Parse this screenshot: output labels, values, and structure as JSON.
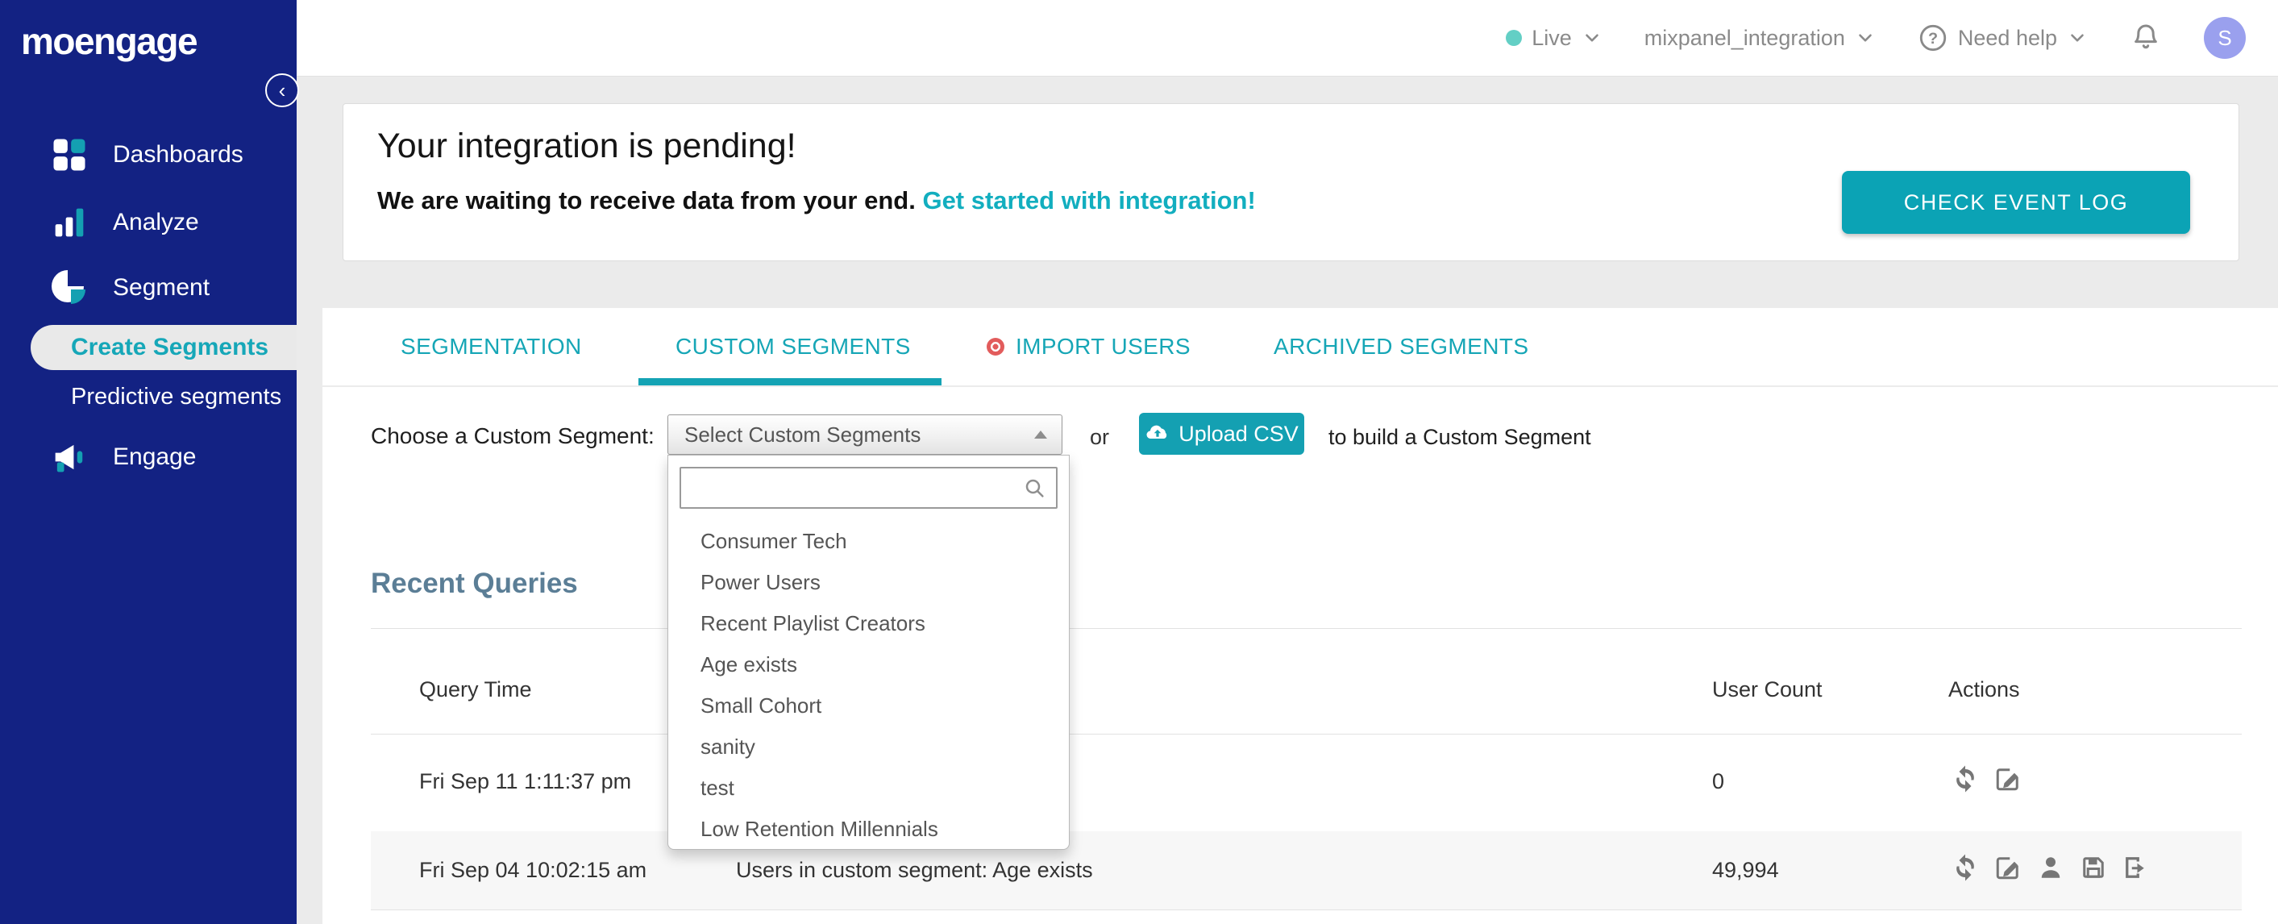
{
  "brand": {
    "logo_text": "moengage",
    "collapse_glyph": "‹"
  },
  "topbar": {
    "environment": "Live",
    "workspace": "mixpanel_integration",
    "help": "Need help",
    "avatar_initial": "S"
  },
  "sidebar": {
    "items": [
      {
        "label": "Dashboards"
      },
      {
        "label": "Analyze"
      },
      {
        "label": "Segment"
      },
      {
        "label": "Create Segments"
      },
      {
        "label": "Predictive segments"
      },
      {
        "label": "Engage"
      }
    ],
    "active_item": "Create Segments"
  },
  "banner": {
    "title": "Your integration is pending!",
    "message": "We are waiting to receive data from your end. ",
    "link": "Get started with integration!",
    "button": "CHECK EVENT LOG"
  },
  "tabs": [
    {
      "label": "SEGMENTATION",
      "active": false
    },
    {
      "label": "CUSTOM SEGMENTS",
      "active": true
    },
    {
      "label": "IMPORT USERS",
      "active": false,
      "has_badge": true
    },
    {
      "label": "ARCHIVED SEGMENTS",
      "active": false
    }
  ],
  "segment_picker": {
    "label": "Choose a Custom Segment:",
    "select_value": "Select Custom Segments",
    "or_text": "or",
    "upload_button": "Upload CSV",
    "suffix_text": "to build a Custom Segment",
    "search_value": "",
    "options": [
      "Consumer Tech",
      "Power Users",
      "Recent Playlist Creators",
      "Age exists",
      "Small Cohort",
      "sanity",
      "test",
      "Low Retention Millennials"
    ]
  },
  "recent_queries": {
    "title": "Recent Queries",
    "columns": {
      "query_time": "Query Time",
      "user_count": "User Count",
      "actions": "Actions"
    },
    "rows": [
      {
        "query_time": "Fri Sep 11 1:11:37 pm",
        "query_info": "",
        "user_count": "0",
        "actions": [
          "refresh",
          "edit"
        ]
      },
      {
        "query_time": "Fri Sep 04 10:02:15 am",
        "query_info": "Users in custom segment: Age exists",
        "user_count": "49,994",
        "actions": [
          "refresh",
          "edit",
          "user",
          "save",
          "export"
        ]
      }
    ]
  },
  "colors": {
    "accent_teal": "#14a3b4",
    "button_teal": "#0ba3b5",
    "sidebar_navy": "#132283",
    "live_dot": "#63cfc5",
    "avatar_bg": "#9aa0ee",
    "import_badge_red": "#e25c5c",
    "heading_slate": "#5b7e96",
    "row_alt_bg": "#f7f7f7",
    "page_bg": "#ebebeb"
  }
}
